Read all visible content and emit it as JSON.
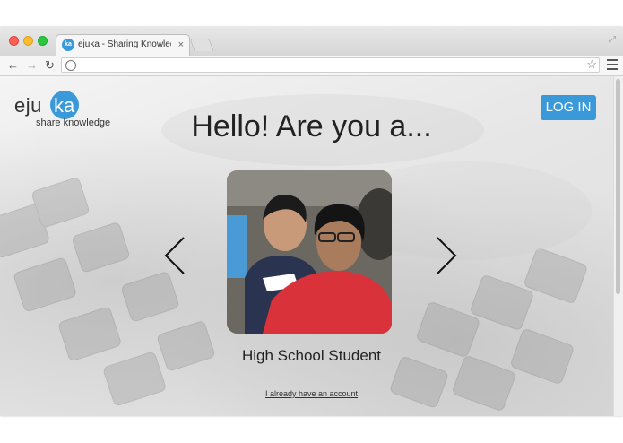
{
  "browser": {
    "tab_title": "ejuka - Sharing Knowledge",
    "tab_favicon_text": "ka",
    "tab_close": "×",
    "url": ""
  },
  "icons": {
    "back": "back-arrow-icon",
    "forward": "forward-arrow-icon",
    "reload": "reload-icon",
    "globe": "globe-icon",
    "bookmark": "star-icon",
    "menu": "hamburger-menu-icon"
  },
  "logo": {
    "prefix": "eju",
    "suffix": "ka",
    "tagline": "share knowledge"
  },
  "header": {
    "login_label": "LOG IN"
  },
  "main": {
    "heading": "Hello! Are you a...",
    "role_caption": "High School Student",
    "account_link": "I already have an account"
  },
  "colors": {
    "brand_blue": "#3a9ad9",
    "text_dark": "#222222",
    "shirt_red": "#d9323a",
    "shirt_navy": "#2a3350"
  }
}
